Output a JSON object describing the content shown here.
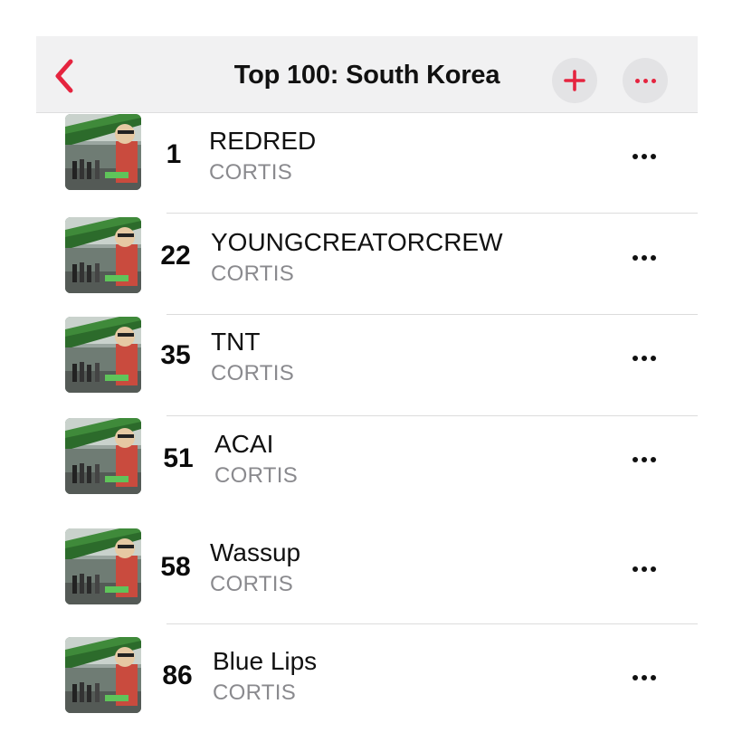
{
  "header": {
    "title": "Top 100: South Korea",
    "back_icon": "chevron-left-icon",
    "add_icon": "plus-icon",
    "more_icon": "ellipsis-icon"
  },
  "tracks": [
    {
      "rank": "1",
      "title": "REDRED",
      "artist": "CORTIS"
    },
    {
      "rank": "22",
      "title": "YOUNGCREATORCREW",
      "artist": "CORTIS"
    },
    {
      "rank": "35",
      "title": "TNT",
      "artist": "CORTIS"
    },
    {
      "rank": "51",
      "title": "ACAI",
      "artist": "CORTIS"
    },
    {
      "rank": "58",
      "title": "Wassup",
      "artist": "CORTIS"
    },
    {
      "rank": "86",
      "title": "Blue Lips",
      "artist": "CORTIS"
    }
  ],
  "colors": {
    "accent": "#e5243f",
    "artist_text": "#8a8a8e",
    "header_bg": "#f1f1f2"
  }
}
